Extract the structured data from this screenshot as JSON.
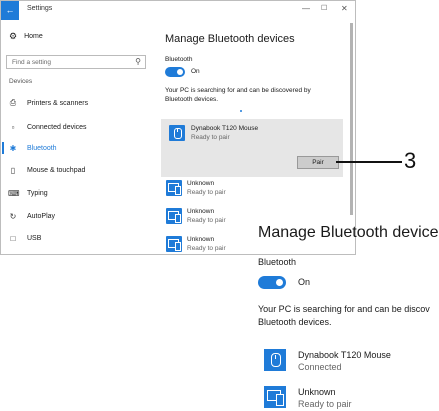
{
  "window": {
    "title": "Settings",
    "back_glyph": "←",
    "minimize_glyph": "—",
    "maximize_glyph": "☐",
    "close_glyph": "✕"
  },
  "sidebar": {
    "home_label": "Home",
    "search_placeholder": "Find a setting",
    "section_label": "Devices",
    "items": [
      {
        "label": "Printers & scanners",
        "icon": "printer-icon",
        "glyph": "⎙"
      },
      {
        "label": "Connected devices",
        "icon": "devices-icon",
        "glyph": "▫"
      },
      {
        "label": "Bluetooth",
        "icon": "bluetooth-icon",
        "glyph": "✱",
        "active": true
      },
      {
        "label": "Mouse & touchpad",
        "icon": "mouse-icon",
        "glyph": "▯"
      },
      {
        "label": "Typing",
        "icon": "keyboard-icon",
        "glyph": "⌨"
      },
      {
        "label": "AutoPlay",
        "icon": "autoplay-icon",
        "glyph": "↻"
      },
      {
        "label": "USB",
        "icon": "usb-icon",
        "glyph": "□"
      }
    ]
  },
  "main": {
    "title": "Manage Bluetooth devices",
    "bluetooth_label": "Bluetooth",
    "toggle_state": "On",
    "description": "Your PC is searching for and can be discovered by Bluetooth devices.",
    "selected_device": {
      "name": "Dynabook T120 Mouse",
      "status": "Ready to pair",
      "icon": "mouse-icon"
    },
    "pair_button": "Pair",
    "devices": [
      {
        "name": "Unknown",
        "status": "Ready to pair",
        "icon": "computer-icon"
      },
      {
        "name": "Unknown",
        "status": "Ready to pair",
        "icon": "computer-icon"
      },
      {
        "name": "Unknown",
        "status": "Ready to pair",
        "icon": "computer-icon"
      }
    ]
  },
  "callout": {
    "number": "3"
  },
  "zoomed": {
    "title": "Manage Bluetooth devices",
    "bluetooth_label": "Bluetooth",
    "toggle_state": "On",
    "description_line1": "Your PC is searching for and can be discov",
    "description_line2": "Bluetooth devices.",
    "device1": {
      "name": "Dynabook T120 Mouse",
      "status": "Connected"
    },
    "device2": {
      "name": "Unknown",
      "status": "Ready to pair"
    }
  },
  "colors": {
    "accent": "#1f7bd8",
    "selected_bg": "#e6e6e6"
  }
}
